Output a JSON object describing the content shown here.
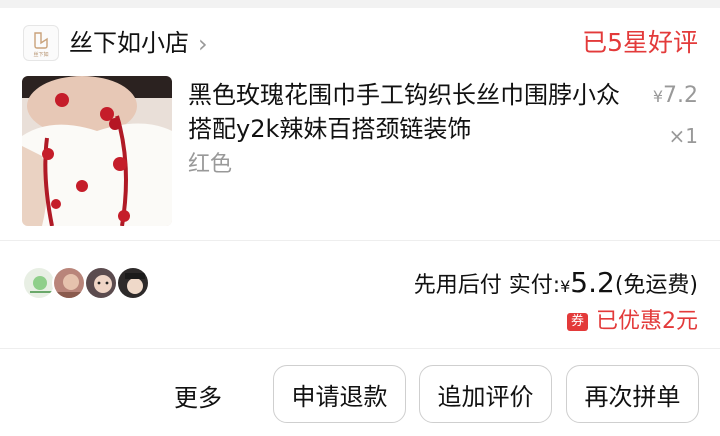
{
  "shop": {
    "name": "丝下如小店",
    "logo_text": "丝下如"
  },
  "review_status": "已5星好评",
  "product": {
    "title": "黑色玫瑰花围巾手工钩织长丝巾围脖小众搭配y2k辣妹百搭颈链装饰",
    "variant": "红色",
    "currency": "¥",
    "price": "7.2",
    "quantity": "×1"
  },
  "group_buyers": {
    "avatars": [
      "avatar-1",
      "avatar-2",
      "avatar-3",
      "avatar-4"
    ]
  },
  "payment": {
    "prefix": "先用后付 实付:",
    "currency": "¥",
    "amount": "5.2",
    "note": "(免运费)"
  },
  "discount": {
    "badge": "券",
    "text": "已优惠2元"
  },
  "actions": {
    "more": "更多",
    "refund": "申请退款",
    "add_review": "追加评价",
    "buy_again": "再次拼单"
  },
  "colors": {
    "accent_red": "#e33a3a",
    "muted_text": "#999999"
  }
}
